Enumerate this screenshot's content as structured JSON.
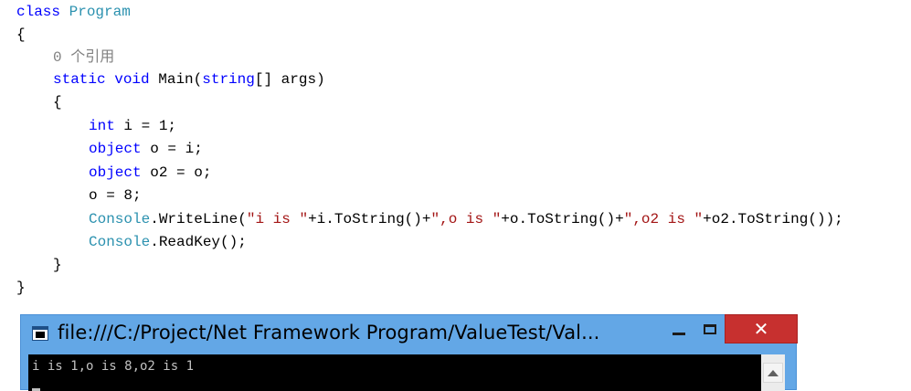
{
  "editor": {
    "lines": {
      "class_kw": "class",
      "class_name": "Program",
      "open_brace_class": "{",
      "codelens": "0 个引用",
      "main_static": "static",
      "main_void": "void",
      "main_name": "Main(",
      "main_string": "string",
      "main_rest": "[] args)",
      "open_brace_main": "{",
      "l1_kw": "int",
      "l1_rest": " i = 1;",
      "l2_kw": "object",
      "l2_rest": " o = i;",
      "l3_kw": "object",
      "l3_rest": " o2 = o;",
      "l4": "o = 8;",
      "l5_type": "Console",
      "l5_a": ".WriteLine(",
      "l5_s1": "\"i is \"",
      "l5_b": "+i.ToString()+",
      "l5_s2": "\",o is \"",
      "l5_c": "+o.ToString()+",
      "l5_s3": "\",o2 is \"",
      "l5_d": "+o2.ToString());",
      "l6_type": "Console",
      "l6_rest": ".ReadKey();",
      "close_brace_main": "}",
      "close_brace_class": "}"
    }
  },
  "console_window": {
    "title": "file:///C:/Project/Net Framework Program/ValueTest/Val...",
    "output": "i is 1,o is 8,o2 is 1",
    "close_label": "✕",
    "icons": {
      "window": "console-app-icon",
      "minimize": "minimize-icon",
      "maximize": "maximize-icon",
      "close": "close-icon",
      "scroll_up": "scroll-up-arrow-icon"
    }
  },
  "colors": {
    "keyword": "#0000ff",
    "type": "#2b91af",
    "string": "#a31515",
    "codelens": "#808080",
    "titlebar": "#63a7e6",
    "close_button": "#c7302f",
    "console_background": "#000000",
    "console_text": "#c0c0c0"
  }
}
